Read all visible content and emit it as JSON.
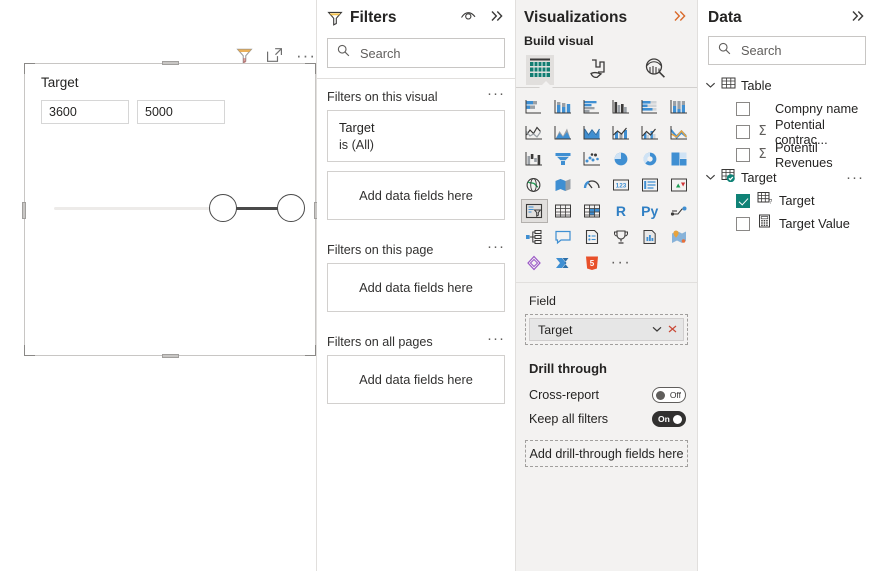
{
  "canvas": {
    "visual_header": {
      "filter_icon": "filter-funnel-icon",
      "focus_icon": "focus-mode-icon",
      "more_label": "···"
    },
    "slicer": {
      "title": "Target",
      "min_value": "3600",
      "max_value": "5000",
      "slider": {
        "left_handle_pct": 63,
        "right_handle_pct": 91,
        "fill_color": "#4a4a4a",
        "track_color": "#edebe9"
      }
    }
  },
  "filters": {
    "title": "Filters",
    "hide_icon": "eye-icon",
    "collapse_icon": "chevron-double-right-icon",
    "search": {
      "placeholder": "Search",
      "value": "",
      "icon": "search-icon"
    },
    "sections": [
      {
        "label": "Filters on this visual",
        "more_label": "···",
        "cards": [
          {
            "title": "Target",
            "sub": "is (All)"
          }
        ],
        "dropzone": "Add data fields here"
      },
      {
        "label": "Filters on this page",
        "more_label": "···",
        "cards": [],
        "dropzone": "Add data fields here"
      },
      {
        "label": "Filters on all pages",
        "more_label": "···",
        "cards": [],
        "dropzone": "Add data fields here"
      }
    ]
  },
  "visualizations": {
    "title": "Visualizations",
    "collapse_icon": "chevron-double-right-icon",
    "build_visual_label": "Build visual",
    "tabs": [
      {
        "name": "build-visual-tab",
        "icon": "table-bars-icon",
        "selected": true
      },
      {
        "name": "format-tab",
        "icon": "paintbrush-icon",
        "selected": false
      },
      {
        "name": "analytics-tab",
        "icon": "magnifier-chart-icon",
        "selected": false
      }
    ],
    "gallery": [
      {
        "name": "stacked-bar-chart",
        "selected": false
      },
      {
        "name": "stacked-column-chart",
        "selected": false
      },
      {
        "name": "clustered-bar-chart",
        "selected": false
      },
      {
        "name": "clustered-column-chart",
        "selected": false
      },
      {
        "name": "100-stacked-bar-chart",
        "selected": false
      },
      {
        "name": "100-stacked-column-chart",
        "selected": false
      },
      {
        "name": "line-chart",
        "selected": false
      },
      {
        "name": "area-chart",
        "selected": false
      },
      {
        "name": "stacked-area-chart",
        "selected": false
      },
      {
        "name": "line-stacked-column-chart",
        "selected": false
      },
      {
        "name": "line-clustered-column-chart",
        "selected": false
      },
      {
        "name": "ribbon-chart",
        "selected": false
      },
      {
        "name": "waterfall-chart",
        "selected": false
      },
      {
        "name": "funnel-chart",
        "selected": false
      },
      {
        "name": "scatter-chart",
        "selected": false
      },
      {
        "name": "pie-chart",
        "selected": false
      },
      {
        "name": "donut-chart",
        "selected": false
      },
      {
        "name": "treemap-chart",
        "selected": false
      },
      {
        "name": "map-visual",
        "selected": false
      },
      {
        "name": "filled-map-visual",
        "selected": false
      },
      {
        "name": "gauge-visual",
        "selected": false
      },
      {
        "name": "card-visual",
        "selected": false
      },
      {
        "name": "multi-row-card-visual",
        "selected": false
      },
      {
        "name": "kpi-visual",
        "selected": false
      },
      {
        "name": "slicer-visual",
        "selected": true
      },
      {
        "name": "table-visual",
        "selected": false
      },
      {
        "name": "matrix-visual",
        "selected": false
      },
      {
        "name": "r-script-visual",
        "label": "R",
        "selected": false
      },
      {
        "name": "python-script-visual",
        "label": "Py",
        "selected": false
      },
      {
        "name": "key-influencers-visual",
        "selected": false
      },
      {
        "name": "decomposition-tree-visual",
        "selected": false
      },
      {
        "name": "q-and-a-visual",
        "selected": false
      },
      {
        "name": "narrative-visual",
        "selected": false
      },
      {
        "name": "metrics-visual",
        "selected": false
      },
      {
        "name": "paginated-report-visual",
        "selected": false
      },
      {
        "name": "azure-map-visual",
        "selected": false
      },
      {
        "name": "power-apps-visual",
        "selected": false
      },
      {
        "name": "power-automate-visual",
        "selected": false
      },
      {
        "name": "html-viewer-visual",
        "label": "5",
        "selected": false
      },
      {
        "name": "more-visuals",
        "label": "···",
        "selected": false
      }
    ],
    "field_section": {
      "label": "Field",
      "pill": {
        "name": "Target",
        "chevron_icon": "chevron-down-icon",
        "remove_icon": "close-icon"
      }
    },
    "drill_through": {
      "title": "Drill through",
      "rows": [
        {
          "label": "Cross-report",
          "state": "Off",
          "on": false
        },
        {
          "label": "Keep all filters",
          "state": "On",
          "on": true
        }
      ],
      "dropzone": "Add drill-through fields here"
    }
  },
  "data": {
    "title": "Data",
    "collapse_icon": "chevron-double-right-icon",
    "search": {
      "placeholder": "Search",
      "value": "",
      "icon": "search-icon"
    },
    "tables": [
      {
        "name": "Table",
        "expanded": true,
        "icon": "table-icon",
        "has_more": false,
        "fields": [
          {
            "name": "Compny name",
            "checked": false,
            "measure": false,
            "icon": "none"
          },
          {
            "name": "Potential contrac...",
            "checked": false,
            "measure": true,
            "icon": "sigma-icon"
          },
          {
            "name": "Potentil Revenues",
            "checked": false,
            "measure": true,
            "icon": "sigma-icon"
          }
        ]
      },
      {
        "name": "Target",
        "expanded": true,
        "icon": "table-checked-icon",
        "has_more": true,
        "more_label": "···",
        "fields": [
          {
            "name": "Target",
            "checked": true,
            "measure": false,
            "icon": "table-question-icon"
          },
          {
            "name": "Target Value",
            "checked": false,
            "measure": false,
            "icon": "calculator-icon"
          }
        ]
      }
    ]
  },
  "colors": {
    "accent_teal": "#0f8276",
    "chevron_orange": "#d96a2b",
    "viz_blue": "#2f7fc4",
    "pane_bg": "#f3f2f1",
    "border": "#e1dfdd"
  }
}
